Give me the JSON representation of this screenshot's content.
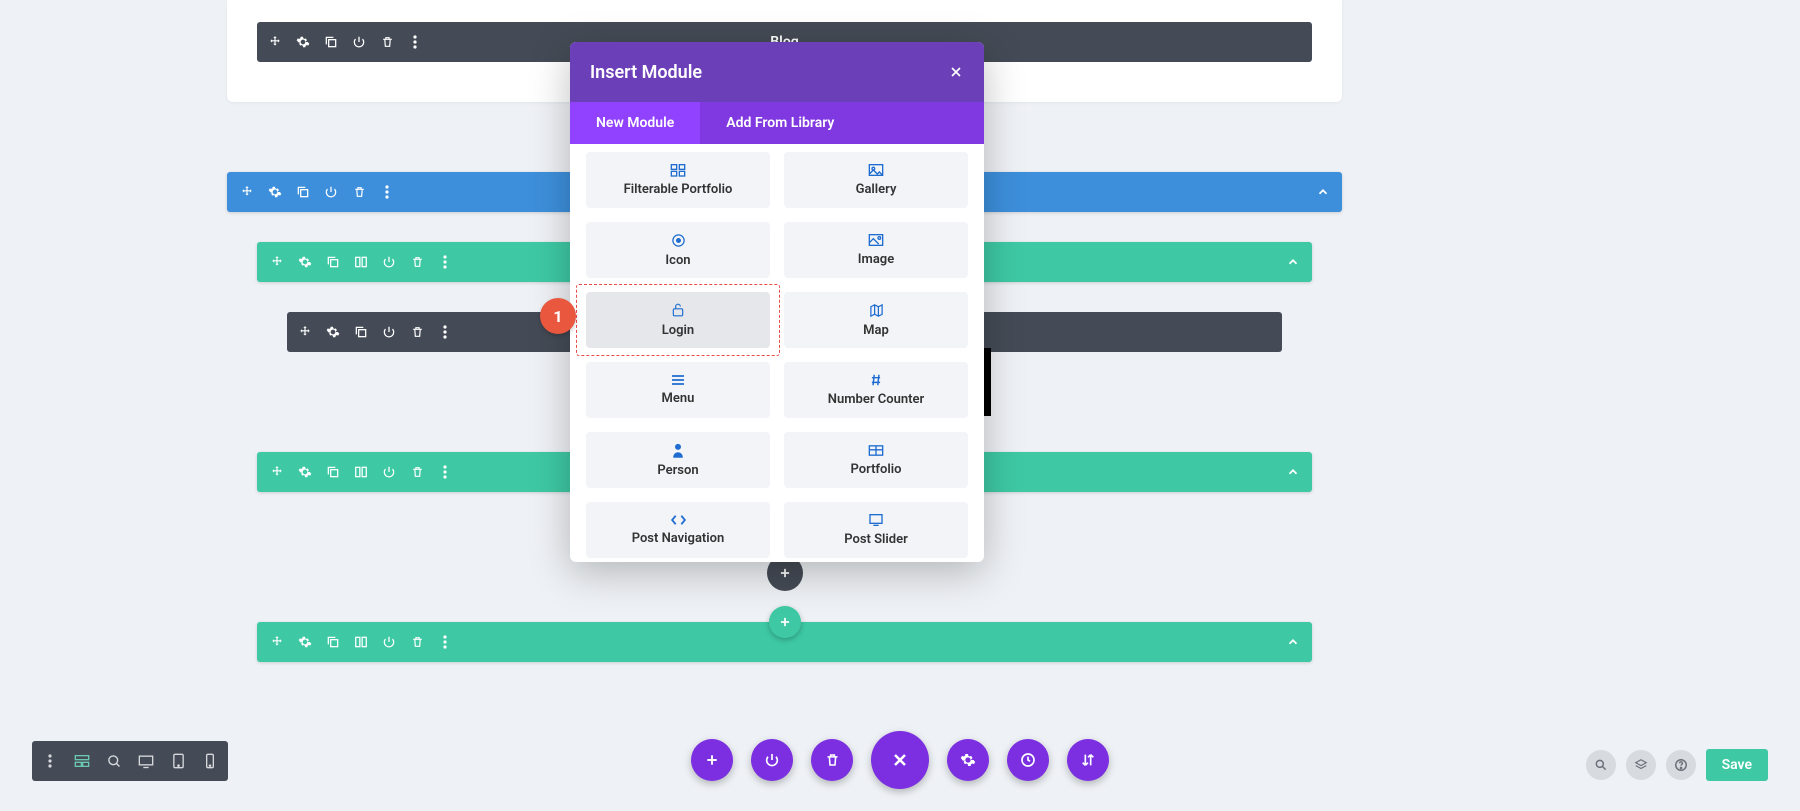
{
  "canvas": {
    "top_module_label": "Blog"
  },
  "modal": {
    "title": "Insert Module",
    "tabs": {
      "new": "New Module",
      "library": "Add From Library"
    },
    "options": [
      {
        "label": "Filterable Portfolio",
        "icon": "grid"
      },
      {
        "label": "Gallery",
        "icon": "image"
      },
      {
        "label": "Icon",
        "icon": "target"
      },
      {
        "label": "Image",
        "icon": "picture"
      },
      {
        "label": "Login",
        "icon": "lock"
      },
      {
        "label": "Map",
        "icon": "map"
      },
      {
        "label": "Menu",
        "icon": "menu"
      },
      {
        "label": "Number Counter",
        "icon": "hash"
      },
      {
        "label": "Person",
        "icon": "person"
      },
      {
        "label": "Portfolio",
        "icon": "table"
      },
      {
        "label": "Post Navigation",
        "icon": "code"
      },
      {
        "label": "Post Slider",
        "icon": "slider"
      }
    ]
  },
  "callout": {
    "number": "1",
    "target": "Login"
  },
  "footer": {
    "save_label": "Save"
  },
  "colors": {
    "purple_header": "#6b3fb7",
    "purple_tabs": "#8039e0",
    "purple_active": "#9042ff",
    "blue_section": "#3d8fdb",
    "green_row": "#3ec9a4",
    "dark_module": "#454b56",
    "callout_red": "#e9573f",
    "icon_blue": "#1f6dd0"
  }
}
